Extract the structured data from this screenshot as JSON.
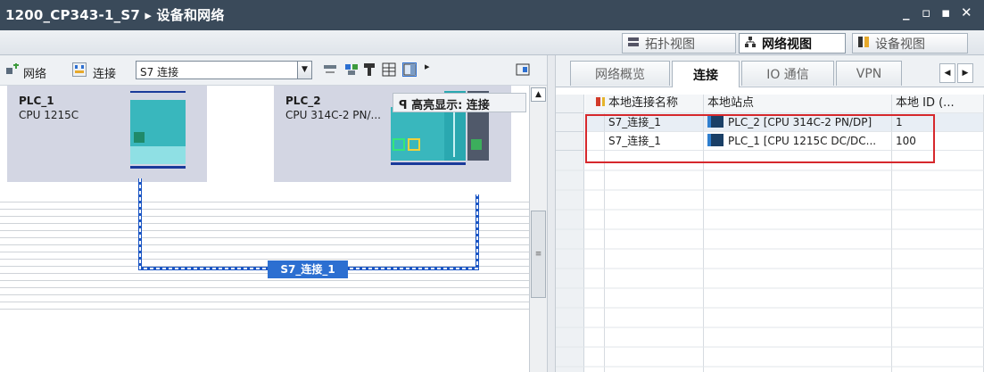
{
  "window": {
    "title": "1200_CP343-1_S7 ▸ 设备和网络",
    "controls": [
      "_",
      "▫",
      "▪",
      "✕"
    ]
  },
  "view_tabs": [
    {
      "label": "拓扑视图",
      "icon": "topology-icon",
      "active": false
    },
    {
      "label": "网络视图",
      "icon": "network-icon",
      "active": true
    },
    {
      "label": "设备视图",
      "icon": "device-icon",
      "active": false
    }
  ],
  "net_toolbar": {
    "network_label": "网络",
    "connect_label": "连接",
    "connection_type": "S7 连接"
  },
  "highlight_tip": "高亮显示: 连接",
  "devices": [
    {
      "name": "PLC_1",
      "type": "CPU 1215C"
    },
    {
      "name": "PLC_2",
      "type": "CPU 314C-2 PN/..."
    }
  ],
  "connection_label": "S7_连接_1",
  "right_tabs": [
    "网络概览",
    "连接",
    "IO 通信",
    "VPN"
  ],
  "right_active_tab": "连接",
  "table": {
    "headers": {
      "name": "本地连接名称",
      "station": "本地站点",
      "id": "本地 ID (..."
    },
    "rows": [
      {
        "name": "S7_连接_1",
        "station": "PLC_2 [CPU 314C-2 PN/DP]",
        "id": "1"
      },
      {
        "name": "S7_连接_1",
        "station": "PLC_1 [CPU 1215C DC/DC...",
        "id": "100"
      }
    ]
  },
  "colors": {
    "titlebar": "#3a4a5a",
    "connection_blue": "#2c6fd1",
    "highlight_red": "#d6282c",
    "device_bg": "#d3d6e3"
  }
}
